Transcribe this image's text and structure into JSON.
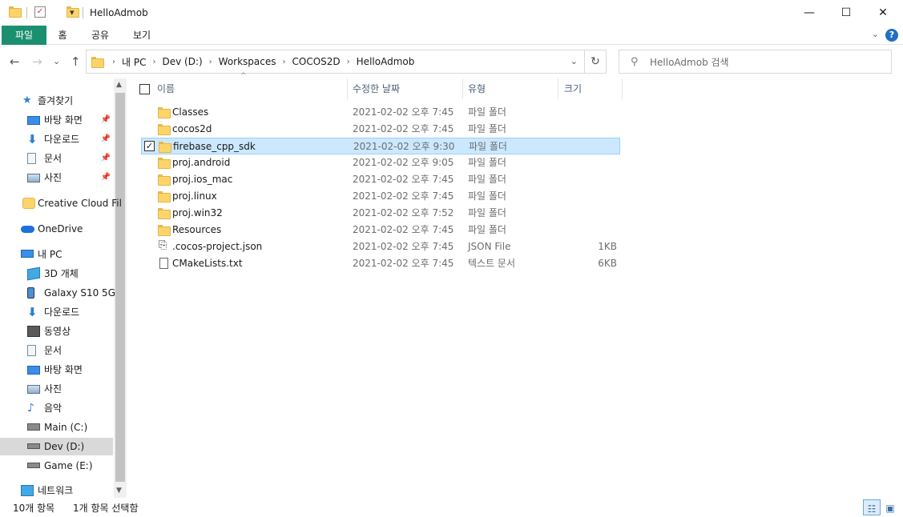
{
  "window": {
    "title": "HelloAdmob",
    "min_glyph": "—",
    "max_glyph": "☐",
    "close_glyph": "✕",
    "qa_dropdown_glyph": "▾"
  },
  "ribbon": {
    "tabs": [
      "파일",
      "홈",
      "공유",
      "보기"
    ],
    "expand_glyph": "⌄",
    "help_glyph": "?"
  },
  "nav": {
    "back_glyph": "←",
    "forward_glyph": "→",
    "recent_glyph": "⌄",
    "up_glyph": "↑",
    "refresh_glyph": "↻",
    "drop_glyph": "⌄",
    "crumb_sep": "›",
    "breadcrumbs": [
      "내 PC",
      "Dev (D:)",
      "Workspaces",
      "COCOS2D",
      "HelloAdmob"
    ]
  },
  "search": {
    "placeholder": "HelloAdmob 검색",
    "icon_glyph": "⚲"
  },
  "sidebar": {
    "pin_glyph": "📌",
    "scroll_up": "▲",
    "scroll_down": "▼",
    "items": [
      {
        "label": "즐겨찾기",
        "icon": "star-icon",
        "pinned": false
      },
      {
        "label": "바탕 화면",
        "icon": "desktop-icon",
        "pinned": true
      },
      {
        "label": "다운로드",
        "icon": "download-icon",
        "pinned": true
      },
      {
        "label": "문서",
        "icon": "document-icon",
        "pinned": true
      },
      {
        "label": "사진",
        "icon": "pictures-icon",
        "pinned": true
      },
      {
        "label": "Creative Cloud Fil",
        "icon": "creative-cloud-icon",
        "pinned": false
      },
      {
        "label": "OneDrive",
        "icon": "onedrive-icon",
        "pinned": false
      },
      {
        "label": "내 PC",
        "icon": "pc-icon",
        "pinned": false
      },
      {
        "label": "3D 개체",
        "icon": "3d-objects-icon",
        "pinned": false
      },
      {
        "label": "Galaxy S10 5G",
        "icon": "phone-icon",
        "pinned": false
      },
      {
        "label": "다운로드",
        "icon": "download-icon",
        "pinned": false
      },
      {
        "label": "동영상",
        "icon": "video-icon",
        "pinned": false
      },
      {
        "label": "문서",
        "icon": "document-icon",
        "pinned": false
      },
      {
        "label": "바탕 화면",
        "icon": "desktop-icon",
        "pinned": false
      },
      {
        "label": "사진",
        "icon": "pictures-icon",
        "pinned": false
      },
      {
        "label": "음악",
        "icon": "music-icon",
        "pinned": false
      },
      {
        "label": "Main (C:)",
        "icon": "drive-c-icon",
        "pinned": false
      },
      {
        "label": "Dev (D:)",
        "icon": "drive-icon",
        "pinned": false,
        "selected": true
      },
      {
        "label": "Game (E:)",
        "icon": "drive-icon",
        "pinned": false
      },
      {
        "label": "네트워크",
        "icon": "network-icon",
        "pinned": false
      }
    ]
  },
  "list": {
    "columns": {
      "name": "이름",
      "date": "수정한 날짜",
      "type": "유형",
      "size": "크기"
    },
    "sort_glyph": "^",
    "check_glyph": "✓",
    "rows": [
      {
        "name": "Classes",
        "date": "2021-02-02 오후 7:45",
        "type": "파일 폴더",
        "size": "",
        "kind": "folder"
      },
      {
        "name": "cocos2d",
        "date": "2021-02-02 오후 7:45",
        "type": "파일 폴더",
        "size": "",
        "kind": "folder"
      },
      {
        "name": "firebase_cpp_sdk",
        "date": "2021-02-02 오후 9:30",
        "type": "파일 폴더",
        "size": "",
        "kind": "folder",
        "selected": true
      },
      {
        "name": "proj.android",
        "date": "2021-02-02 오후 9:05",
        "type": "파일 폴더",
        "size": "",
        "kind": "folder"
      },
      {
        "name": "proj.ios_mac",
        "date": "2021-02-02 오후 7:45",
        "type": "파일 폴더",
        "size": "",
        "kind": "folder"
      },
      {
        "name": "proj.linux",
        "date": "2021-02-02 오후 7:45",
        "type": "파일 폴더",
        "size": "",
        "kind": "folder"
      },
      {
        "name": "proj.win32",
        "date": "2021-02-02 오후 7:52",
        "type": "파일 폴더",
        "size": "",
        "kind": "folder"
      },
      {
        "name": "Resources",
        "date": "2021-02-02 오후 7:45",
        "type": "파일 폴더",
        "size": "",
        "kind": "folder"
      },
      {
        "name": ".cocos-project.json",
        "date": "2021-02-02 오후 7:45",
        "type": "JSON File",
        "size": "1KB",
        "kind": "json"
      },
      {
        "name": "CMakeLists.txt",
        "date": "2021-02-02 오후 7:45",
        "type": "텍스트 문서",
        "size": "6KB",
        "kind": "text"
      }
    ]
  },
  "status": {
    "count": "10개 항목",
    "selection": "1개 항목 선택함",
    "details_view_glyph": "☷",
    "large_icons_glyph": "▣"
  }
}
